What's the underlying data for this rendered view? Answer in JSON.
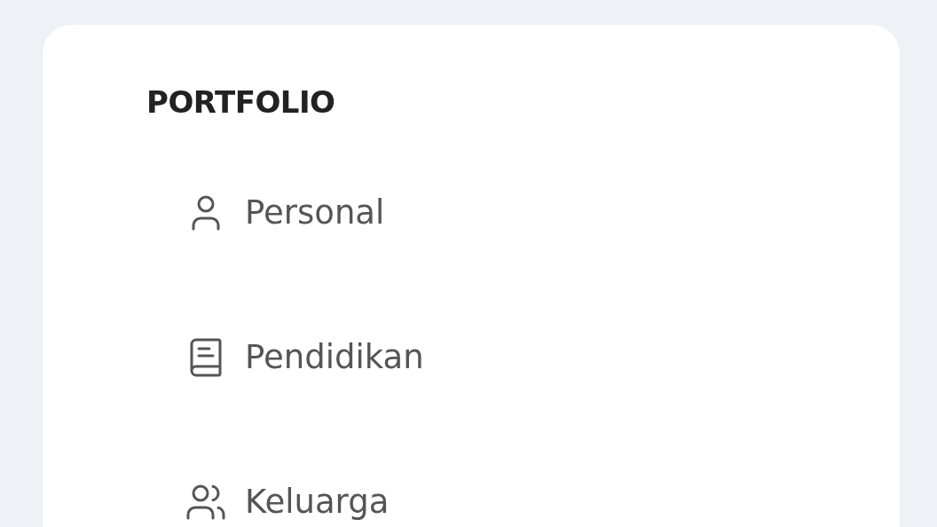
{
  "sidebar": {
    "heading": "PORTFOLIO",
    "items": [
      {
        "label": "Personal"
      },
      {
        "label": "Pendidikan"
      },
      {
        "label": "Keluarga"
      }
    ]
  }
}
